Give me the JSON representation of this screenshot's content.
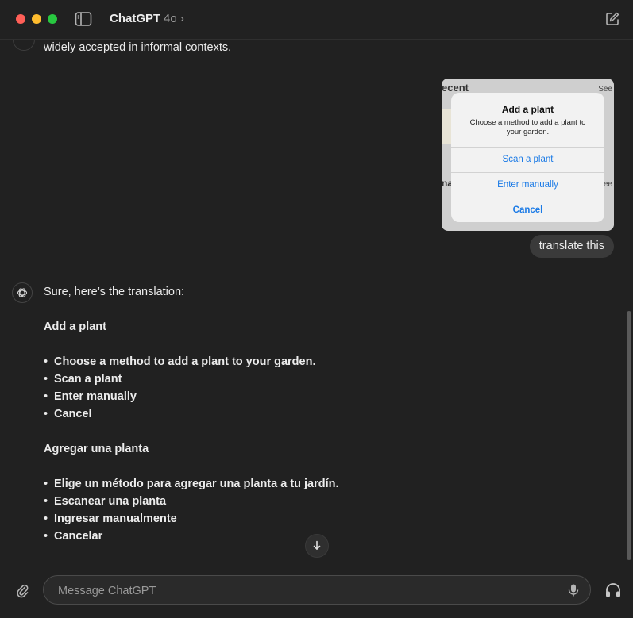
{
  "window": {
    "title": "ChatGPT",
    "model": "4o ›"
  },
  "messages": {
    "prev_tail": "widely accepted in informal contexts.",
    "image": {
      "bg_title": "ecent",
      "bg_see": "See",
      "bg_na": "na",
      "bg_see2": "ee",
      "alert_title": "Add a plant",
      "alert_message": "Choose a method to add a plant to your garden.",
      "btn_scan": "Scan a plant",
      "btn_manual": "Enter manually",
      "btn_cancel": "Cancel"
    },
    "user_text": "translate this",
    "reply": {
      "intro": "Sure, here’s the translation:",
      "heading_en": "Add a plant",
      "bullets_en": [
        "Choose a method to add a plant to your garden.",
        "Scan a plant",
        "Enter manually",
        "Cancel"
      ],
      "heading_es": "Agregar una planta",
      "bullets_es": [
        "Elige un método para agregar una planta a tu jardín.",
        "Escanear una planta",
        "Ingresar manualmente",
        "Cancelar"
      ]
    }
  },
  "composer": {
    "placeholder": "Message ChatGPT"
  },
  "colors": {
    "background": "#212121",
    "accent_blue": "#1a7ae6",
    "bubble": "#3a3a3a"
  }
}
